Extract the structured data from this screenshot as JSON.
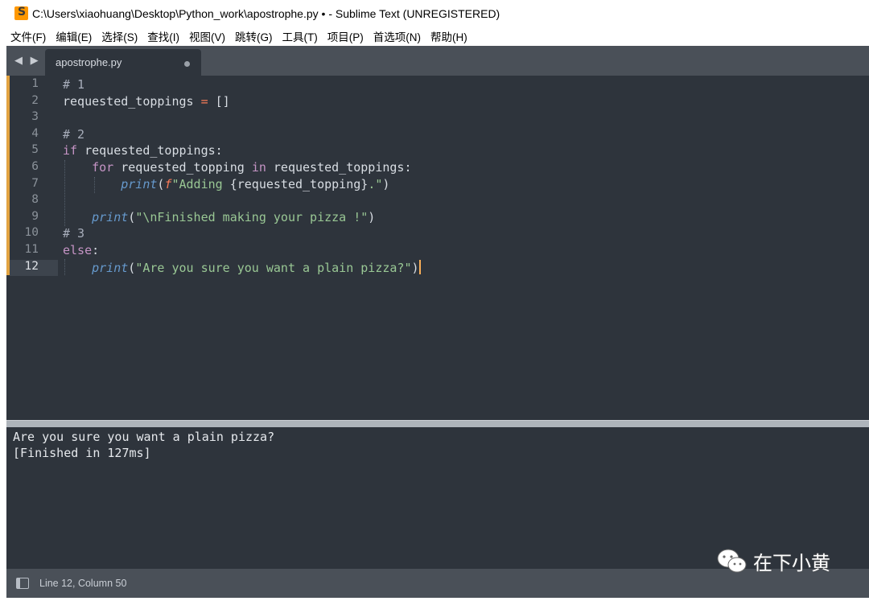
{
  "window": {
    "title": "C:\\Users\\xiaohuang\\Desktop\\Python_work\\apostrophe.py • - Sublime Text (UNREGISTERED)"
  },
  "menu": [
    "文件(F)",
    "编辑(E)",
    "选择(S)",
    "查找(I)",
    "视图(V)",
    "跳转(G)",
    "工具(T)",
    "项目(P)",
    "首选项(N)",
    "帮助(H)"
  ],
  "tab": {
    "label": "apostrophe.py",
    "nav": "◀ ▶"
  },
  "editor": {
    "line_numbers": [
      "1",
      "2",
      "3",
      "4",
      "5",
      "6",
      "7",
      "8",
      "9",
      "10",
      "11",
      "12"
    ],
    "active_line": "12",
    "lines": [
      [
        [
          "cm",
          "# 1"
        ]
      ],
      [
        [
          "pn",
          "requested_toppings "
        ],
        [
          "op",
          "="
        ],
        [
          "pn",
          " []"
        ]
      ],
      [],
      [
        [
          "cm",
          "# 2"
        ]
      ],
      [
        [
          "kw",
          "if"
        ],
        [
          "pn",
          " requested_toppings:"
        ]
      ],
      [
        [
          "pn",
          "    "
        ],
        [
          "kw",
          "for"
        ],
        [
          "pn",
          " requested_topping "
        ],
        [
          "kw",
          "in"
        ],
        [
          "pn",
          " requested_toppings:"
        ]
      ],
      [
        [
          "pn",
          "        "
        ],
        [
          "fn",
          "print"
        ],
        [
          "pn",
          "("
        ],
        [
          "fp",
          "f"
        ],
        [
          "str",
          "\"Adding "
        ],
        [
          "pn",
          "{requested_topping}"
        ],
        [
          "str",
          ".\""
        ],
        [
          "pn",
          ")"
        ]
      ],
      [],
      [
        [
          "pn",
          "    "
        ],
        [
          "fn",
          "print"
        ],
        [
          "pn",
          "("
        ],
        [
          "str",
          "\"\\nFinished making your pizza !\""
        ],
        [
          "pn",
          ")"
        ]
      ],
      [
        [
          "cm",
          "# 3"
        ]
      ],
      [
        [
          "kw",
          "else"
        ],
        [
          "pn",
          ":"
        ]
      ],
      [
        [
          "pn",
          "    "
        ],
        [
          "fn",
          "print"
        ],
        [
          "pn",
          "("
        ],
        [
          "str",
          "\"Are you sure you want a plain pizza?\""
        ],
        [
          "pn",
          ")"
        ]
      ]
    ]
  },
  "output": {
    "lines": [
      "Are you sure you want a plain pizza?",
      "[Finished in 127ms]"
    ]
  },
  "status": {
    "position": "Line 12, Column 50"
  },
  "watermark": {
    "text": "在下小黄"
  },
  "colors": {
    "background": "#2e343c",
    "keyword": "#c594c5",
    "string": "#99c794",
    "function": "#6699cc",
    "operator": "#f97b58",
    "comment": "#a7adba",
    "modified_marker": "#e2a341"
  }
}
